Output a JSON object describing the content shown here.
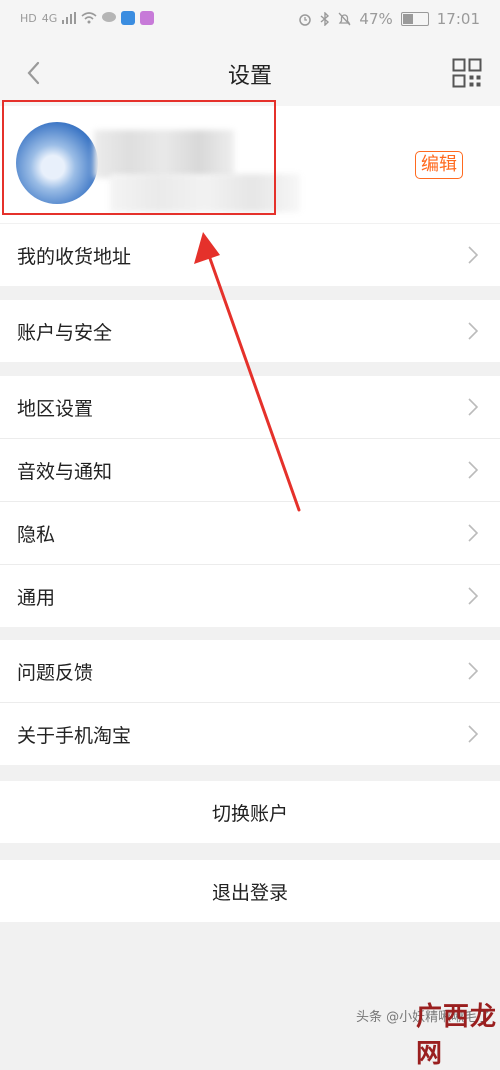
{
  "status_bar": {
    "left_labels": [
      "HD",
      "4G"
    ],
    "battery_percent": "47%",
    "battery_level": 0.47,
    "time": "17:01"
  },
  "nav": {
    "title": "设置",
    "back_icon": "chevron-left-icon",
    "right_icon": "qr-code-icon"
  },
  "profile": {
    "edit_label": "编辑"
  },
  "menu_groups": [
    {
      "items": [
        {
          "label": "我的收货地址"
        }
      ]
    },
    {
      "items": [
        {
          "label": "账户与安全"
        }
      ]
    },
    {
      "items": [
        {
          "label": "地区设置"
        },
        {
          "label": "音效与通知"
        },
        {
          "label": "隐私"
        },
        {
          "label": "通用"
        }
      ]
    },
    {
      "items": [
        {
          "label": "问题反馈"
        },
        {
          "label": "关于手机淘宝"
        }
      ]
    }
  ],
  "switch_account_label": "切换账户",
  "logout_label": "退出登录",
  "watermark": {
    "text": "头条 @小妖精啾啾毛了",
    "logo": "广西龙网"
  },
  "colors": {
    "accent": "#ff6a1f",
    "annotation": "#e5312b"
  }
}
